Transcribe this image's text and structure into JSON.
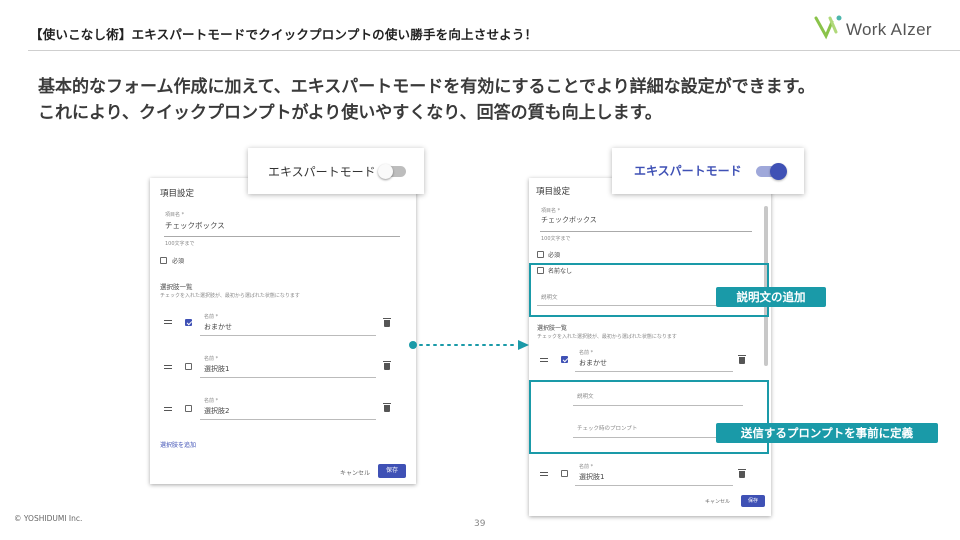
{
  "header": {
    "title": "【使いこなし術】エキスパートモードでクイックプロンプトの使い勝手を向上させよう！",
    "logo_text": "Work AIzer"
  },
  "lead": {
    "line1": "基本的なフォーム作成に加えて、エキスパートモードを有効にすることでより詳細な設定ができます。",
    "line2": "これにより、クイックプロンプトがより使いやすくなり、回答の質も向上します。"
  },
  "left_panel": {
    "expert_toggle_label": "エキスパートモード",
    "expert_on": false,
    "section_title": "項目設定",
    "item_name_label": "項目名 *",
    "item_name_value": "チェックボックス",
    "item_name_hint": "100文字まで",
    "required_label": "必須",
    "options_title": "選択肢一覧",
    "options_hint": "チェックを入れた選択肢が、最初から選ばれた状態になります",
    "options": [
      {
        "field_label": "名前 *",
        "value": "おまかせ",
        "checked": true
      },
      {
        "field_label": "名前 *",
        "value": "選択肢1",
        "checked": false
      },
      {
        "field_label": "名前 *",
        "value": "選択肢2",
        "checked": false
      }
    ],
    "add_option": "選択肢を追加",
    "cancel": "キャンセル",
    "save": "保存"
  },
  "right_panel": {
    "expert_toggle_label": "エキスパートモード",
    "expert_on": true,
    "section_title": "項目設定",
    "item_name_label": "項目名 *",
    "item_name_value": "チェックボックス",
    "item_name_hint": "100文字まで",
    "required_label": "必須",
    "unnamed_label": "名前なし",
    "description_placeholder": "説明文",
    "options_title": "選択肢一覧",
    "options_hint": "チェックを入れた選択肢が、最初から選ばれた状態になります",
    "option1": {
      "field_label": "名前 *",
      "value": "おまかせ",
      "checked": true
    },
    "option_description": "説明文",
    "option_prompt": "チェック時のプロンプト",
    "option2": {
      "field_label": "名前 *",
      "value": "選択肢1",
      "checked": false
    },
    "cancel": "キャンセル",
    "save": "保存"
  },
  "callouts": {
    "description_add": "説明文の追加",
    "prompt_define": "送信するプロンプトを事前に定義"
  },
  "colors": {
    "accent": "#3f51b5",
    "highlight": "#1a9aa8",
    "toggle_on": "#3f51b5"
  },
  "footer": {
    "copyright": "© YOSHIDUMI Inc.",
    "page": "39"
  }
}
